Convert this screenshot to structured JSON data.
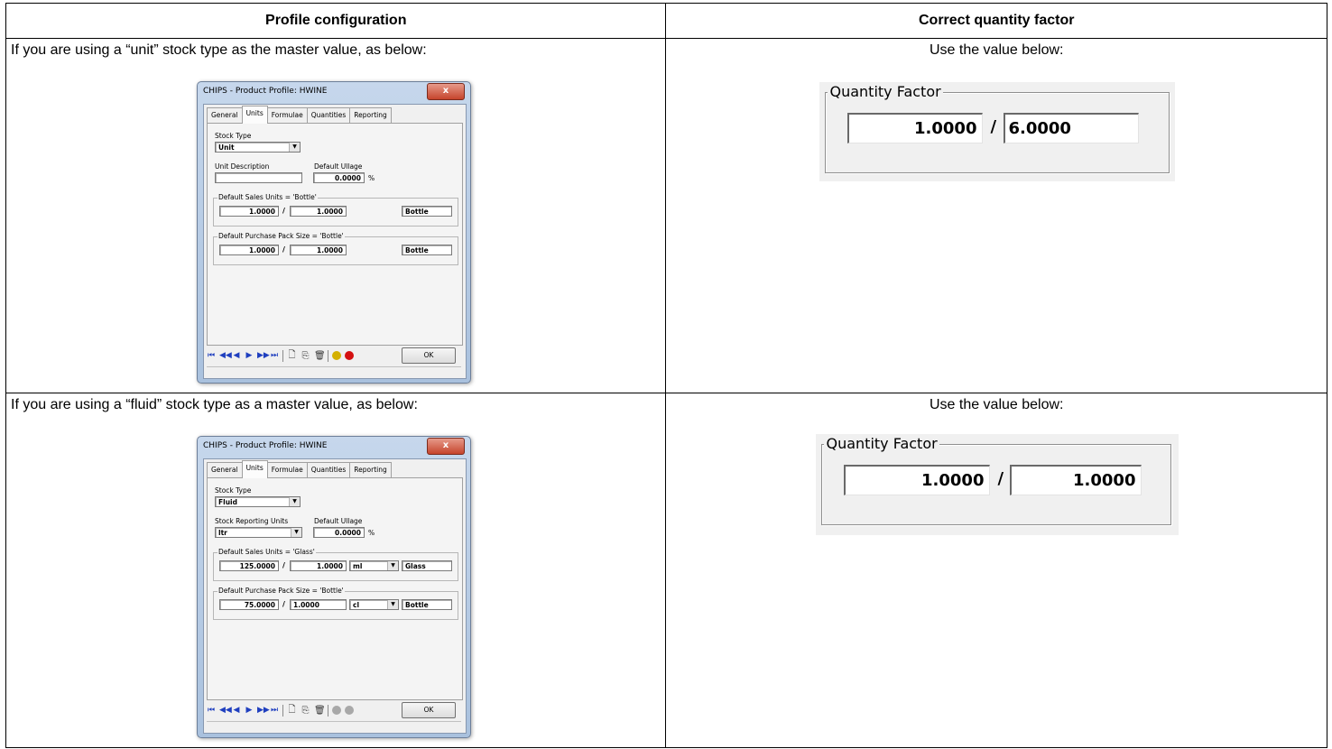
{
  "table": {
    "header_left": "Profile configuration",
    "header_right": "Correct quantity factor"
  },
  "rows": [
    {
      "instruction": "If you are using a “unit” stock type as the master value, as below:",
      "use_text": "Use the value below:",
      "dialog": {
        "title": "CHIPS - Product Profile: HWINE",
        "close_label": "x",
        "tabs": [
          "General",
          "Units",
          "Formulae",
          "Quantities",
          "Reporting"
        ],
        "active_tab": "Units",
        "stock_type_label": "Stock Type",
        "stock_type_value": "Unit",
        "second_label": "Unit Description",
        "second_value": "",
        "ullage_label": "Default Ullage",
        "ullage_value": "0.0000",
        "ullage_unit": "%",
        "sales_group_title": "Default Sales Units = 'Bottle'",
        "sales_a": "1.0000",
        "sales_b": "1.0000",
        "sales_name": "Bottle",
        "purchase_group_title": "Default Purchase Pack Size = 'Bottle'",
        "purchase_a": "1.0000",
        "purchase_b": "1.0000",
        "purchase_name": "Bottle",
        "ok_label": "OK"
      },
      "quantity_factor": {
        "legend": "Quantity Factor",
        "numerator": "1.0000",
        "denominator": "6.0000",
        "slash": "/"
      }
    },
    {
      "instruction": "If you are using a “fluid” stock type as a master value, as below:",
      "use_text": "Use the value below:",
      "dialog": {
        "title": "CHIPS - Product Profile: HWINE",
        "close_label": "x",
        "tabs": [
          "General",
          "Units",
          "Formulae",
          "Quantities",
          "Reporting"
        ],
        "active_tab": "Units",
        "stock_type_label": "Stock Type",
        "stock_type_value": "Fluid",
        "second_label": "Stock Reporting Units",
        "second_value": "ltr",
        "ullage_label": "Default Ullage",
        "ullage_value": "0.0000",
        "ullage_unit": "%",
        "sales_group_title": "Default Sales Units = 'Glass'",
        "sales_a": "125.0000",
        "sales_b": "1.0000",
        "sales_unit": "ml",
        "sales_name": "Glass",
        "purchase_group_title": "Default Purchase Pack Size = 'Bottle'",
        "purchase_a": "75.0000",
        "purchase_b": "1.0000",
        "purchase_unit": "cl",
        "purchase_name": "Bottle",
        "ok_label": "OK"
      },
      "quantity_factor": {
        "legend": "Quantity Factor",
        "numerator": "1.0000",
        "denominator": "1.0000",
        "slash": "/"
      }
    }
  ],
  "icons": {
    "nav": [
      "first-record-icon",
      "previous-page-icon",
      "previous-record-icon",
      "next-record-icon",
      "next-page-icon",
      "last-record-icon"
    ],
    "actions": [
      "new-record-icon",
      "copy-record-icon",
      "delete-record-icon"
    ],
    "status": [
      "lock-icon",
      "warning-icon"
    ]
  },
  "colors": {
    "nav_icon": "#1f3fbf",
    "lock_active": "#d4b000",
    "warning_active": "#d41010",
    "status_disabled": "#a8a8a8"
  }
}
